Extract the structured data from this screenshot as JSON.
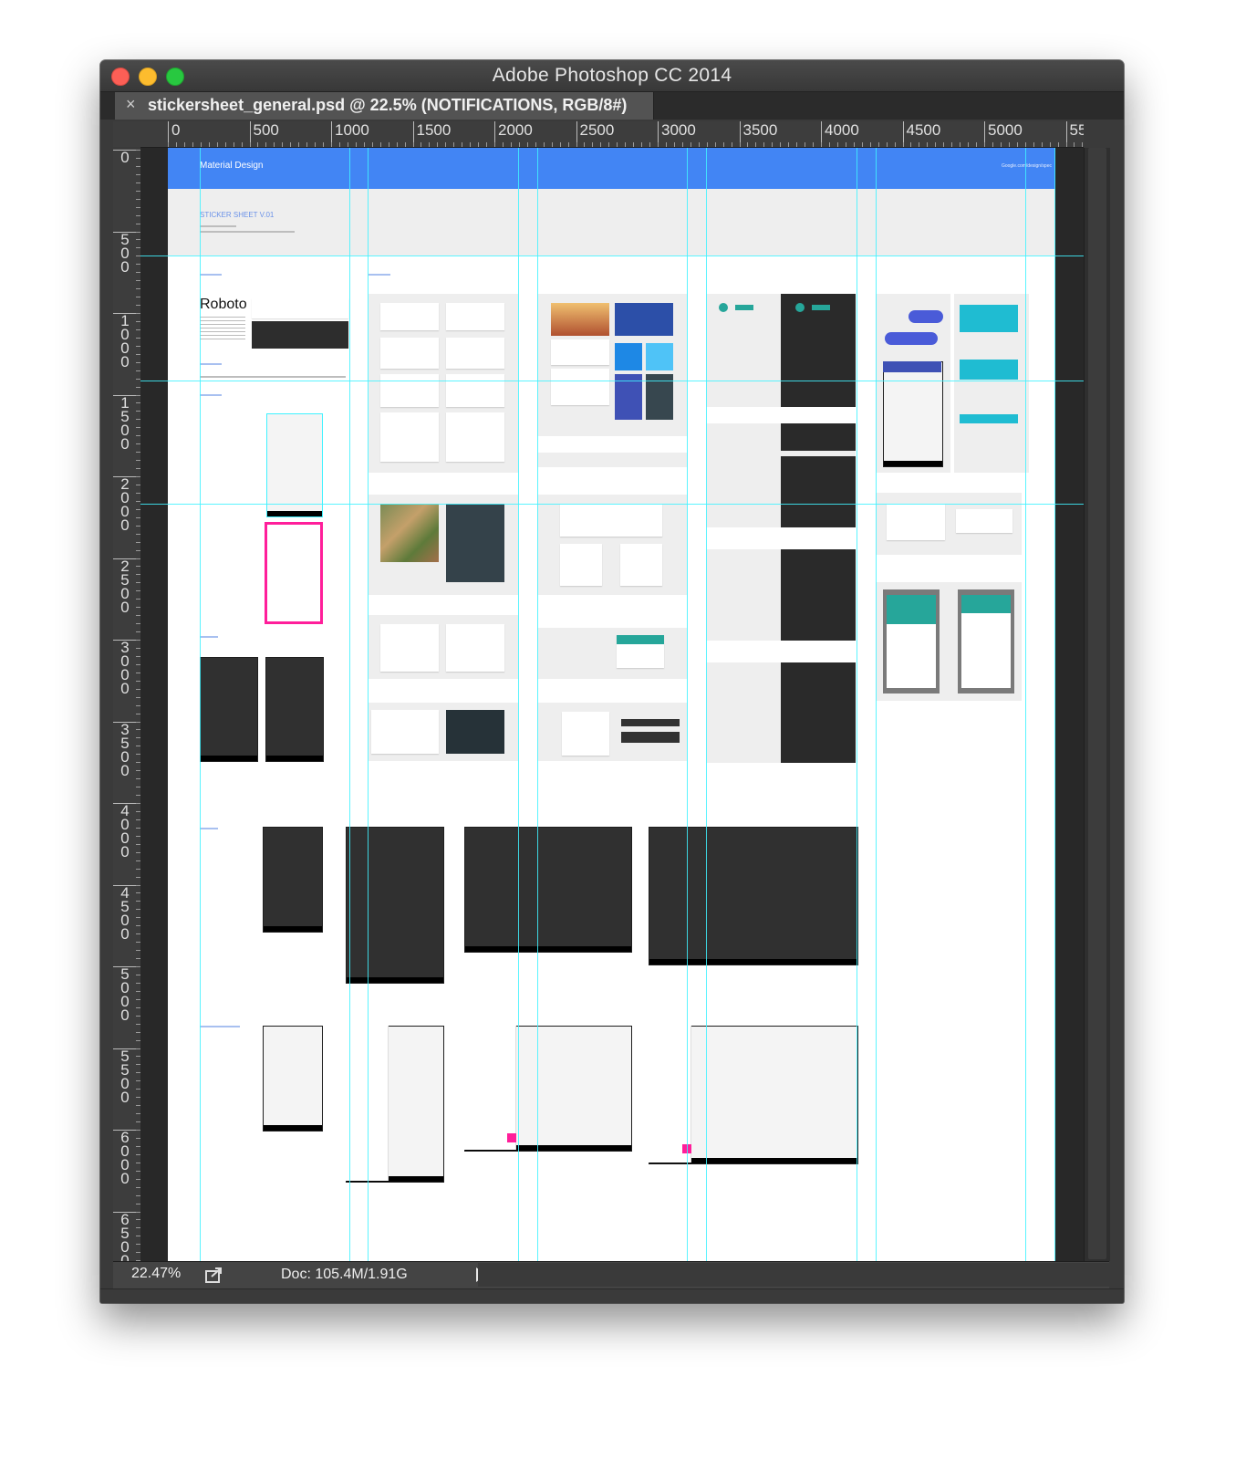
{
  "window": {
    "app_title": "Adobe Photoshop CC 2014",
    "controls": {
      "close": "close-window",
      "minimize": "minimize-window",
      "zoom": "zoom-window"
    }
  },
  "tab": {
    "close_glyph": "×",
    "title": "stickersheet_general.psd @ 22.5% (NOTIFICATIONS, RGB/8#)"
  },
  "rulers": {
    "horizontal": [
      "0",
      "500",
      "1000",
      "1500",
      "2000",
      "2500",
      "3000",
      "3500",
      "4000",
      "4500",
      "5000",
      "55"
    ],
    "vertical": [
      "0",
      "500",
      "1000",
      "1500",
      "2000",
      "2500",
      "3000",
      "3500",
      "4000",
      "4500",
      "5000",
      "5500",
      "6000",
      "6500"
    ]
  },
  "document": {
    "header_title": "Material Design",
    "header_url": "Google.com/design/spec",
    "sheet_title": "STICKER SHEET V.01",
    "font_sample": "Roboto",
    "accent_color": "#4285f4",
    "teal_color": "#26a69a",
    "pink_color": "#ff1e9a",
    "guide_color": "#3ff2ff"
  },
  "status": {
    "zoom": "22.47%",
    "doc_info": "Doc: 105.4M/1.91G"
  },
  "icons": {
    "export": "export-icon",
    "play": "arrow-right-icon"
  }
}
